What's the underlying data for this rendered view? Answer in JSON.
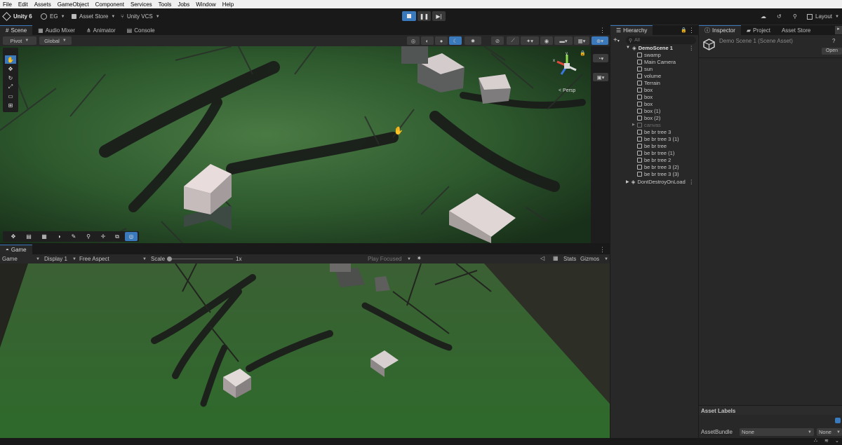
{
  "menu": [
    "File",
    "Edit",
    "Assets",
    "GameObject",
    "Component",
    "Services",
    "Tools",
    "Jobs",
    "Window",
    "Help"
  ],
  "toolbar": {
    "app_label": "Unity 6",
    "account_label": "EG",
    "asset_store_label": "Asset Store",
    "vcs_label": "Unity VCS",
    "layout_label": "Layout"
  },
  "scene_tabs": [
    "Scene",
    "Audio Mixer",
    "Animator",
    "Console"
  ],
  "scene_toolbar": {
    "pivot_label": "Pivot",
    "global_label": "Global",
    "persp_label": "< Persp"
  },
  "game_tab": "Game",
  "game_toolbar": {
    "game_label": "Game",
    "display_label": "Display 1",
    "aspect_label": "Free Aspect",
    "scale_label": "Scale",
    "scale_value": "1x",
    "play_focused_label": "Play Focused",
    "stats_label": "Stats",
    "gizmos_label": "Gizmos"
  },
  "hierarchy": {
    "tab_label": "Hierarchy",
    "search_placeholder": "All",
    "scene_name": "DemoScene 1",
    "items": [
      "swamp",
      "Main Camera",
      "sun",
      "volume",
      "Terrain",
      "box",
      "box",
      "box",
      "box (1)",
      "box (2)",
      "canvas",
      "be br tree 3",
      "be br tree 3 (1)",
      "be br tree",
      "be br tree (1)",
      "be br tree 2",
      "be br tree 3 (2)",
      "be br tree 3 (3)"
    ],
    "dont_destroy": "DontDestroyOnLoad"
  },
  "inspector": {
    "tabs": [
      "Inspector",
      "Project",
      "Asset Store"
    ],
    "asset_title": "Demo Scene 1 (Scene Asset)",
    "open_label": "Open",
    "asset_labels": "Asset Labels",
    "asset_bundle_label": "AssetBundle",
    "asset_bundle_value": "None",
    "asset_variant_value": "None"
  },
  "colors": {
    "accent": "#3a79bb",
    "panel": "#282828",
    "background": "#191919"
  }
}
